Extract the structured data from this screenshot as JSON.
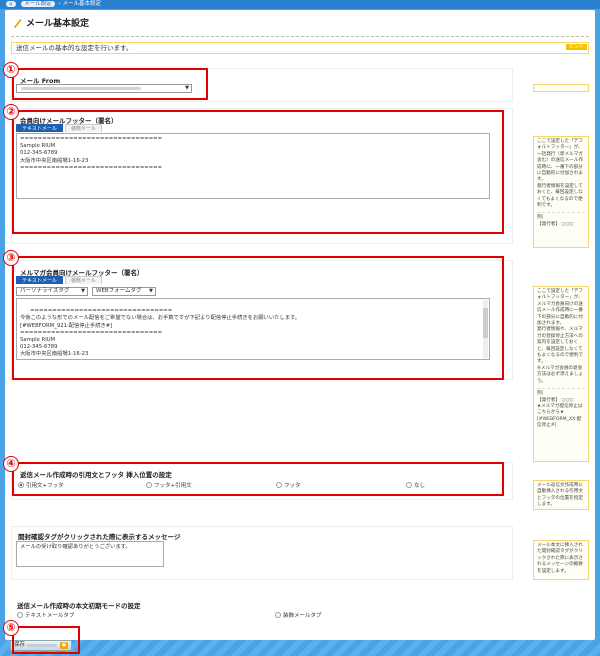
{
  "topbar": {
    "home_icon": "home-icon",
    "crumb1": "メール設定",
    "crumb2": "メール基本設定"
  },
  "page": {
    "title": "メール基本設定",
    "description": "送信メールの基本的な設定を行います。",
    "hint_label": "ヒント"
  },
  "mail_from": {
    "label": "メール From"
  },
  "footer_members": {
    "label": "会員向けメールフッター（署名）",
    "tabs": [
      "テキストメール",
      "装飾メール"
    ],
    "body": "================================\nSample RIUM\n012-345-6789\n大阪市中央区南船場1-16-23\n================================"
  },
  "footer_magazine": {
    "label": "メルマガ会員向けメールフッター（署名）",
    "tabs": [
      "テキストメール",
      "装飾メール"
    ],
    "select1": "パーソナライズタグ",
    "select2": "WEBフォームタグ",
    "body": "================================\n今後このような形でのメール配信をご希望でない場合は、お手数ですが下記より配信停止手続きをお願いいたします。\n[#WEBFORM_921:配信停止手続き#]\n================================\nSample RIUM\n012-345-6789\n大阪市中央区南船場1-16-23\n================================"
  },
  "quote_position": {
    "label": "返信メール作成時の引用文とフッタ 挿入位置の設定",
    "options": [
      "引用文+フッタ",
      "フッタ+引用文",
      "フッタ",
      "なし"
    ],
    "selected": 0
  },
  "open_confirm": {
    "label": "開封確認タグがクリックされた際に表示するメッセージ",
    "value": "メールの受け取り確認ありがとうございます。"
  },
  "body_mode": {
    "label": "送信メール作成時の本文初期モードの設定",
    "options": [
      "テキストメールタブ",
      "装飾メールタブ"
    ]
  },
  "save": {
    "label": "保存"
  },
  "side_notes": {
    "members": "ここで設定した「デフォルトフッター」が、一括発行（新メルマガ含む）の送信メール作成時に、一番下の部分に自動的に付加されます。\n発行者情報を設定しておくと、毎回設定しなくてもよくなるので便利です。",
    "members_example_label": "例）",
    "members_example": "【発行者】 ○○○",
    "magazine": "ここで設定した「デフォルトフッター」が、メルマガ会員向けの送信メール作成時に一番下の部分に自動的に付加されます。\n発行者情報や、メルマガの登録停止方法への案内を設定しておくと、毎回設定しなくてもよくなるので便利です。\n※メルマガ会員の退会方法は必ず添えましょう。",
    "magazine_example_label": "例）",
    "magazine_example": "【発行者】 ○○○\n★メルマガ配信停止はこちらから★\n[#WEBFORM_XX:配信停止#]",
    "quote": "メール返信文作成時に自動挿入される引用文とフッタの位置を指定します。",
    "confirm": "メール本文に挿入された開封確認タグがクリックされた際に表示されるメッセージの概要を設定します。"
  },
  "annotations": [
    "①",
    "②",
    "③",
    "④",
    "⑤"
  ],
  "colors": {
    "highlight": "#e00000",
    "tab_active": "#1e5fb0",
    "note_border": "#f5d76e",
    "background": "#4aa3e6"
  }
}
